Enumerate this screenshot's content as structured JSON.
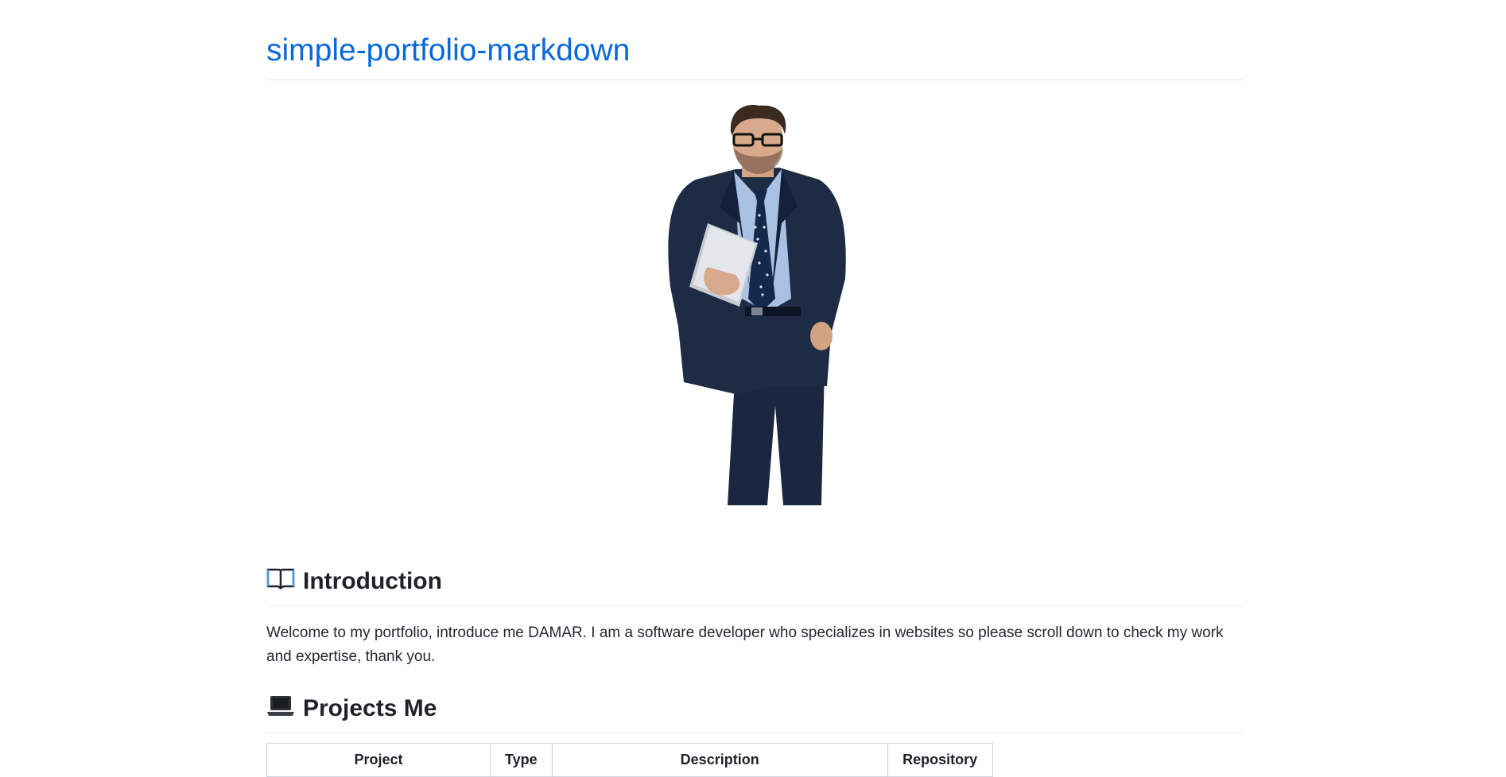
{
  "header": {
    "title": "simple-portfolio-markdown"
  },
  "hero": {
    "image_alt": "portrait of man in suit holding tablet"
  },
  "introduction": {
    "heading": "Introduction",
    "icon": "open-book-icon",
    "text": "Welcome to my portfolio, introduce me DAMAR. I am a software developer who specializes in websites so please scroll down to check my work and expertise, thank you."
  },
  "projects": {
    "heading": "Projects Me",
    "icon": "laptop-icon",
    "table_headers": [
      "Project",
      "Type",
      "Description",
      "Repository"
    ]
  },
  "colors": {
    "link": "#0969da",
    "text": "#24292f",
    "rule": "#e7eaee",
    "suit": "#1e2b44",
    "shirt": "#a9c1e2"
  }
}
